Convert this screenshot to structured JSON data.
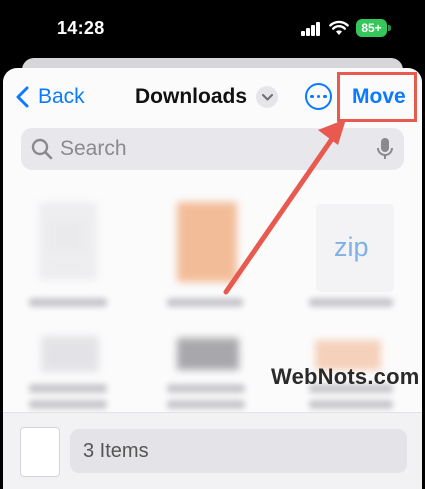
{
  "status_bar": {
    "time": "14:28",
    "battery": "85+"
  },
  "header": {
    "back_label": "Back",
    "title": "Downloads",
    "move_label": "Move"
  },
  "search": {
    "placeholder": "Search"
  },
  "files": [
    {
      "type": "document",
      "name": "blurred"
    },
    {
      "type": "image",
      "name": "blurred"
    },
    {
      "type": "zip",
      "icon_label": "zip"
    },
    {
      "type": "image",
      "name": "blurred"
    },
    {
      "type": "image",
      "name": "blurred"
    },
    {
      "type": "image",
      "name": "blurred"
    }
  ],
  "bottom_bar": {
    "items_count": "3 Items"
  },
  "watermark": "WebNots.com",
  "colors": {
    "accent": "#0a7aff",
    "highlight": "#e8594f",
    "battery": "#34c759"
  }
}
